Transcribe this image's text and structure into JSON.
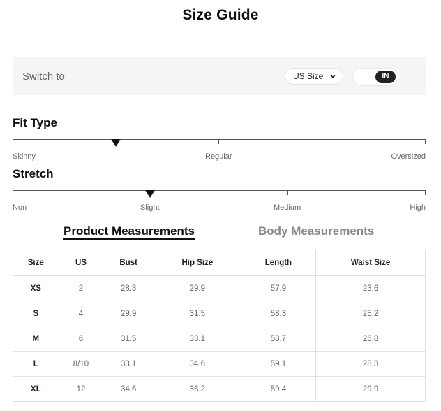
{
  "title": "Size Guide",
  "switch": {
    "label": "Switch to",
    "size_system": "US Size",
    "unit": "IN"
  },
  "fit_type": {
    "title": "Fit Type",
    "labels": [
      "Skinny",
      "Regular",
      "Oversized"
    ]
  },
  "stretch": {
    "title": "Stretch",
    "labels": [
      "Non",
      "Slight",
      "Medium",
      "High"
    ]
  },
  "tabs": {
    "product": "Product Measurements",
    "body": "Body Measurements"
  },
  "table": {
    "headers": [
      "Size",
      "US",
      "Bust",
      "Hip Size",
      "Length",
      "Waist Size"
    ],
    "rows": [
      [
        "XS",
        "2",
        "28.3",
        "29.9",
        "57.9",
        "23.6"
      ],
      [
        "S",
        "4",
        "29.9",
        "31.5",
        "58.3",
        "25.2"
      ],
      [
        "M",
        "6",
        "31.5",
        "33.1",
        "58.7",
        "26.8"
      ],
      [
        "L",
        "8/10",
        "33.1",
        "34.6",
        "59.1",
        "28.3"
      ],
      [
        "XL",
        "12",
        "34.6",
        "36.2",
        "59.4",
        "29.9"
      ]
    ]
  }
}
